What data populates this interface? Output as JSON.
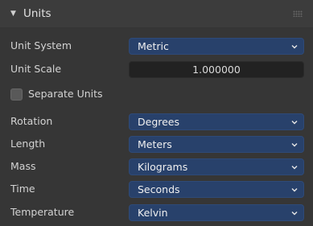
{
  "panel": {
    "title": "Units",
    "collapse_icon": "triangle-down-icon",
    "grip_icon": "drag-grip-icon"
  },
  "fields": {
    "unit_system": {
      "label": "Unit System",
      "value": "Metric"
    },
    "unit_scale": {
      "label": "Unit Scale",
      "value": "1.000000"
    },
    "separate_units": {
      "label": "Separate Units",
      "checked": false
    },
    "rotation": {
      "label": "Rotation",
      "value": "Degrees"
    },
    "length": {
      "label": "Length",
      "value": "Meters"
    },
    "mass": {
      "label": "Mass",
      "value": "Kilograms"
    },
    "time": {
      "label": "Time",
      "value": "Seconds"
    },
    "temperature": {
      "label": "Temperature",
      "value": "Kelvin"
    }
  },
  "colors": {
    "panel_bg": "#363636",
    "header_bg": "#3c3c3c",
    "dropdown_bg": "#28416b",
    "numfield_bg": "#222222",
    "text": "#d6d6d6"
  }
}
